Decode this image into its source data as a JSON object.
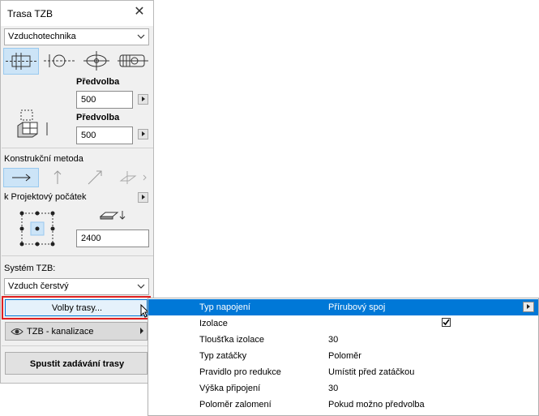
{
  "panel": {
    "title": "Trasa TZB",
    "close_glyph": "✕",
    "domain_select": "Vzduchotechnika",
    "preset1_label": "Předvolba",
    "preset1_value": "500",
    "preset2_label": "Předvolba",
    "preset2_value": "500",
    "construction_label": "Konstrukční metoda",
    "origin_label": "k Projektový počátek",
    "elevation_value": "2400",
    "system_label": "Systém TZB:",
    "system_select": "Vzduch čerstvý",
    "route_options_button": "Volby trasy...",
    "layer_label": "TZB - kanalizace",
    "start_button": "Spustit zadávání trasy"
  },
  "options_table": {
    "rows": [
      {
        "key": "Typ napojení",
        "value": "Přírubový spoj"
      },
      {
        "key": "Izolace",
        "value": ""
      },
      {
        "key": "Tloušťka izolace",
        "value": "30"
      },
      {
        "key": "Typ zatáčky",
        "value": "Poloměr"
      },
      {
        "key": "Pravidlo pro redukce",
        "value": "Umístit před zatáčkou"
      },
      {
        "key": "Výška připojení",
        "value": "30"
      },
      {
        "key": "Poloměr zalomení",
        "value": "Pokud možno předvolba"
      }
    ],
    "izolace_checked": true
  },
  "colors": {
    "highlight": "#0078d7",
    "selected_icon_bg": "#cce4f7",
    "callout_border": "#e02020"
  }
}
